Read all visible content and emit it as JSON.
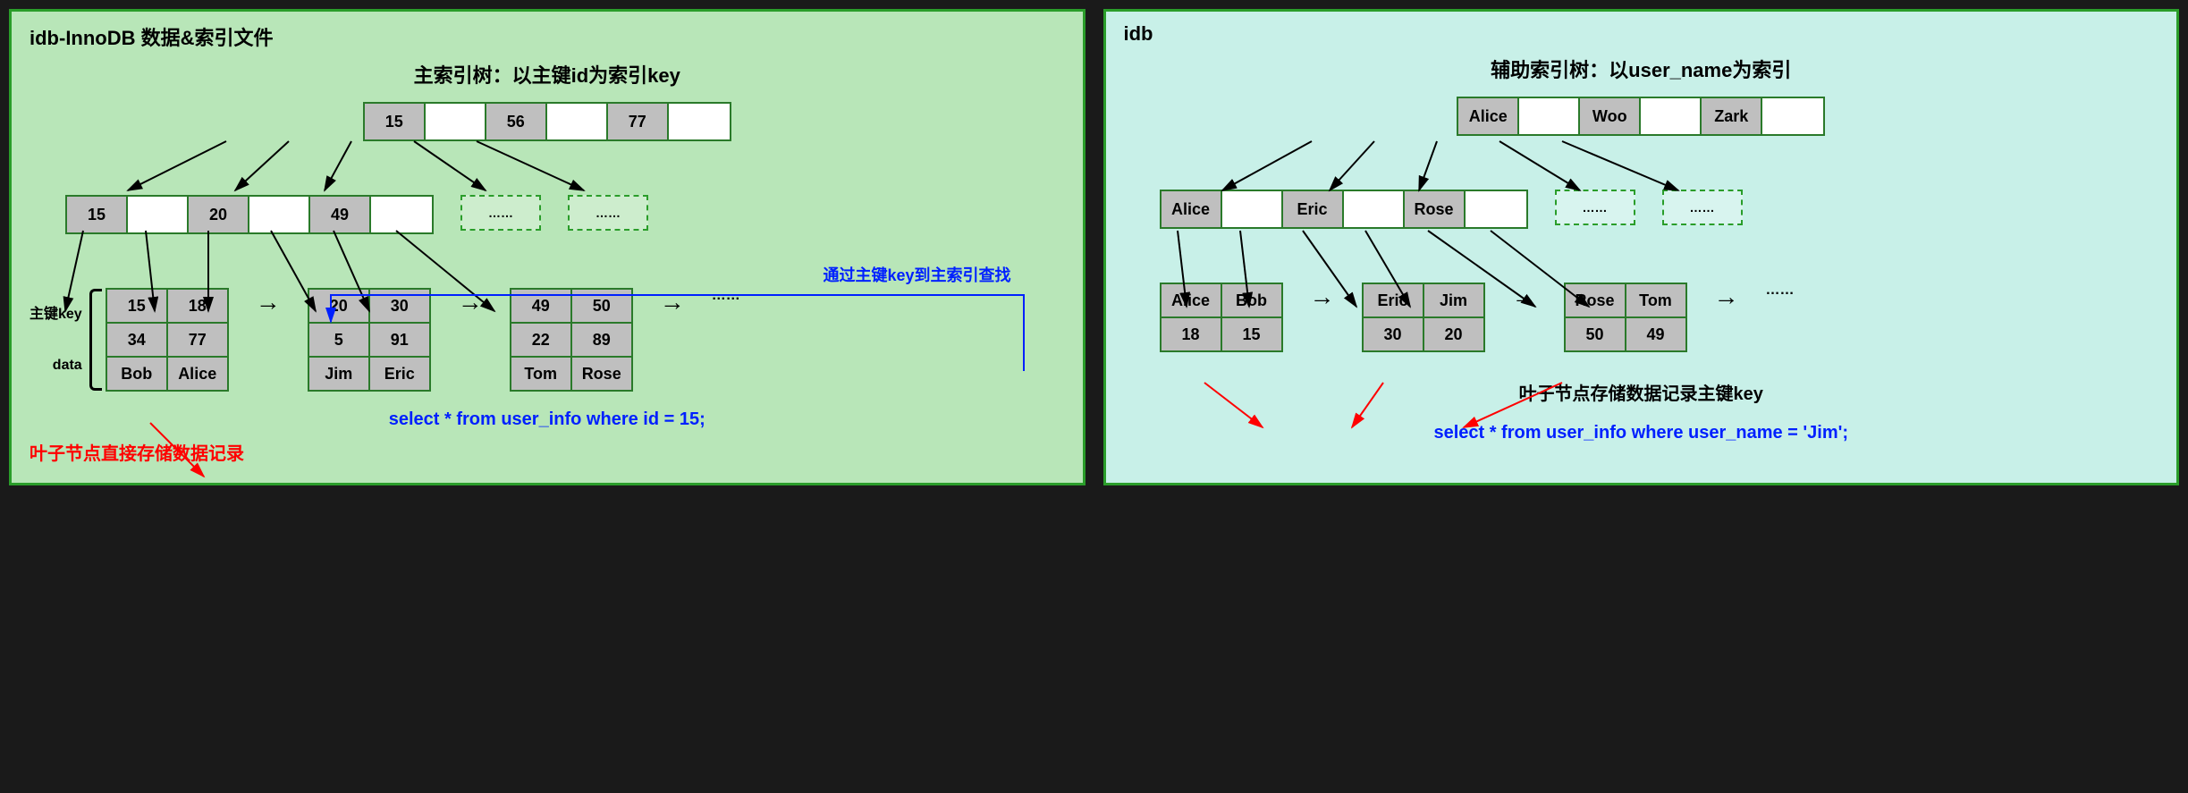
{
  "left": {
    "title": "idb-InnoDB 数据&索引文件",
    "tree_title": "主索引树：以主键id为索引key",
    "root": [
      "15",
      "",
      "56",
      "",
      "77",
      ""
    ],
    "level2": [
      "15",
      "",
      "20",
      "",
      "49",
      ""
    ],
    "dashed": "……",
    "blue_note": "通过主键key到主索引查找",
    "key_label_pk": "主键key",
    "key_label_data": "data",
    "leaf1": {
      "r1": [
        "15",
        "18"
      ],
      "r2": [
        "34",
        "77"
      ],
      "r3": [
        "Bob",
        "Alice"
      ]
    },
    "leaf2": {
      "r1": [
        "20",
        "30"
      ],
      "r2": [
        "5",
        "91"
      ],
      "r3": [
        "Jim",
        "Eric"
      ]
    },
    "leaf3": {
      "r1": [
        "49",
        "50"
      ],
      "r2": [
        "22",
        "89"
      ],
      "r3": [
        "Tom",
        "Rose"
      ]
    },
    "leaf_dots": "……",
    "sql": "select  * from user_info  where id = 15;",
    "red_note": "叶子节点直接存储数据记录"
  },
  "right": {
    "title": "idb",
    "tree_title": "辅助索引树：以user_name为索引",
    "root": [
      "Alice",
      "",
      "Woo",
      "",
      "Zark",
      ""
    ],
    "level2": [
      "Alice",
      "",
      "Eric",
      "",
      "Rose",
      ""
    ],
    "dashed": "……",
    "leaf1": {
      "r1": [
        "Alice",
        "Bob"
      ],
      "r2": [
        "18",
        "15"
      ]
    },
    "leaf2": {
      "r1": [
        "Eric",
        "Jim"
      ],
      "r2": [
        "30",
        "20"
      ]
    },
    "leaf3": {
      "r1": [
        "Rose",
        "Tom"
      ],
      "r2": [
        "50",
        "49"
      ]
    },
    "leaf_dots": "……",
    "black_note": "叶子节点存储数据记录主键key",
    "sql": "select  * from user_info  where user_name = 'Jim';"
  }
}
